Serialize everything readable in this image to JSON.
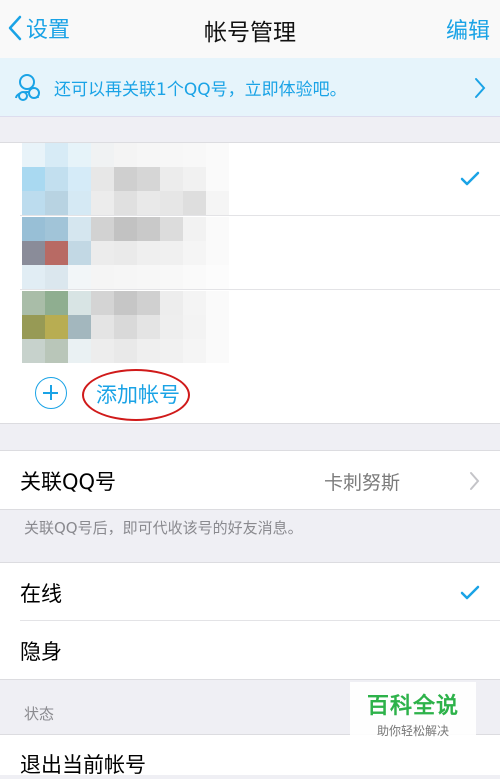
{
  "nav": {
    "back_label": "设置",
    "title": "帐号管理",
    "edit_label": "编辑"
  },
  "banner": {
    "text": "还可以再关联1个QQ号，立即体验吧。",
    "icon": "qq-avatar-icon"
  },
  "accounts": {
    "rows": [
      {
        "obscured": true,
        "selected": true
      },
      {
        "obscured": true,
        "selected": false
      },
      {
        "obscured": true,
        "selected": false
      }
    ],
    "add_label": "添加帐号",
    "annotation_color": "#d01a1a"
  },
  "link_qq": {
    "label": "关联QQ号",
    "value": "卡刺努斯",
    "hint": "关联QQ号后，即可代收该号的好友消息。"
  },
  "status": {
    "options": [
      {
        "label": "在线",
        "selected": true
      },
      {
        "label": "隐身",
        "selected": false
      }
    ],
    "section_label": "状态"
  },
  "logout": {
    "label": "退出当前帐号"
  },
  "watermark": {
    "title": "百科全说",
    "subtitle": "助你轻松解决"
  },
  "colors": {
    "accent": "#1aa3e6",
    "background": "#efeff4"
  }
}
